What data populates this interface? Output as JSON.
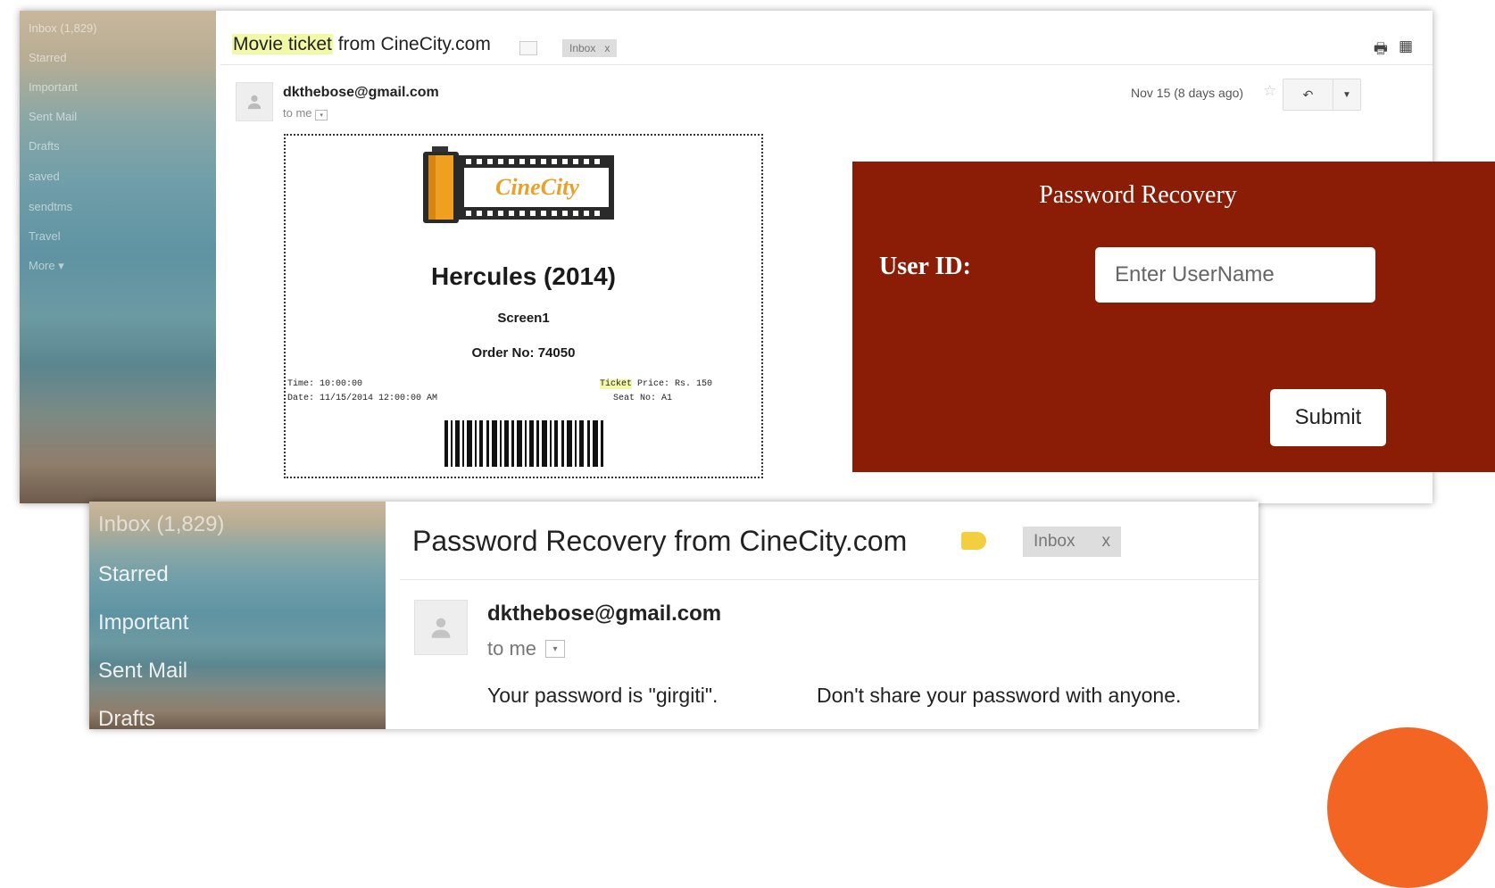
{
  "top_email": {
    "sidebar": [
      "Inbox (1,829)",
      "Starred",
      "Important",
      "Sent Mail",
      "Drafts",
      "saved",
      "sendtms",
      "Travel",
      "More ▾"
    ],
    "subject_prefix": "Movie ticket",
    "subject_suffix": " from CineCity.com",
    "label": "Inbox",
    "label_close": "x",
    "sender": "dkthebose@gmail.com",
    "to_me": "to me",
    "date": "Nov 15 (8 days ago)"
  },
  "ticket": {
    "logo_text": "CineCity",
    "movie_title": "Hercules (2014)",
    "screen": "Screen1",
    "order_no": "Order No: 74050",
    "time": "Time: 10:00:00",
    "date": "Date: 11/15/2014 12:00:00 AM",
    "price_label": "Ticket",
    "price_rest": " Price: Rs. 150",
    "seat": "Seat No: A1"
  },
  "password_recovery": {
    "title": "Password Recovery",
    "user_id_label": "User ID:",
    "input_placeholder": "Enter UserName",
    "submit_label": "Submit",
    "bg_color": "#8b1c05"
  },
  "bottom_email": {
    "sidebar": [
      "Inbox (1,829)",
      "Starred",
      "Important",
      "Sent Mail",
      "Drafts"
    ],
    "subject": "Password Recovery from CineCity.com",
    "label": "Inbox",
    "label_close": "x",
    "sender": "dkthebose@gmail.com",
    "to_me": "to me",
    "body_password": "Your password is \"girgiti\".",
    "body_warning": "Don't share your password with anyone."
  }
}
